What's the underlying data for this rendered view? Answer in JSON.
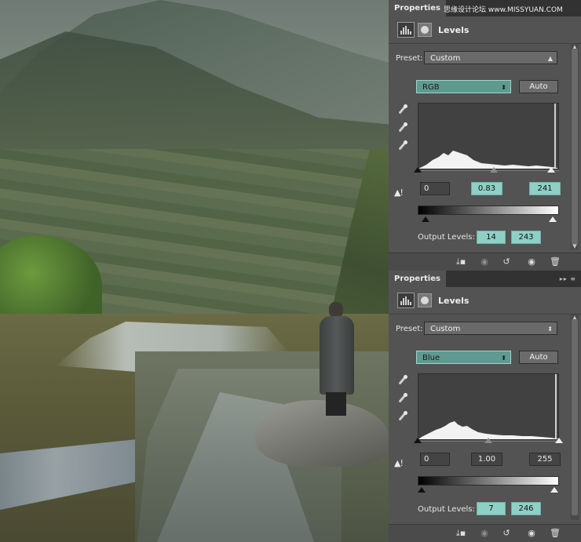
{
  "watermark": "思缘设计论坛 www.MISSYUAN.COM",
  "panels": [
    {
      "tab": "Properties",
      "title": "Levels",
      "preset_label": "Preset:",
      "preset_value": "Custom",
      "channel": "RGB",
      "auto_label": "Auto",
      "input_black": "0",
      "input_gamma": "0.83",
      "input_white": "241",
      "output_label": "Output Levels:",
      "output_black": "14",
      "output_white": "243",
      "input_black_frac": 0.0,
      "input_gamma_frac": 0.54,
      "input_white_frac": 0.945,
      "output_black_frac": 0.055,
      "output_white_frac": 0.953
    },
    {
      "tab": "Properties",
      "title": "Levels",
      "preset_label": "Preset:",
      "preset_value": "Custom",
      "channel": "Blue",
      "auto_label": "Auto",
      "input_black": "0",
      "input_gamma": "1.00",
      "input_white": "255",
      "output_label": "Output Levels:",
      "output_black": "7",
      "output_white": "246",
      "input_black_frac": 0.0,
      "input_gamma_frac": 0.5,
      "input_white_frac": 1.0,
      "output_black_frac": 0.027,
      "output_white_frac": 0.965
    }
  ],
  "icons": {
    "panel_menu": "double-chevron-menu-icon",
    "adjustment": "levels-histogram-icon",
    "mask": "layer-mask-icon",
    "eyedroppers": [
      "black-point-eyedropper-icon",
      "gray-point-eyedropper-icon",
      "white-point-eyedropper-icon"
    ],
    "warning": "histogram-warning-icon",
    "footer": [
      "clip-to-layer-icon",
      "view-previous-icon",
      "reset-icon",
      "visibility-eye-icon",
      "trash-icon"
    ]
  },
  "colors": {
    "panel_bg": "#535353",
    "tab_bar": "#323232",
    "teal_highlight": "#8fd0c6",
    "teal_select": "#5f9a90"
  }
}
